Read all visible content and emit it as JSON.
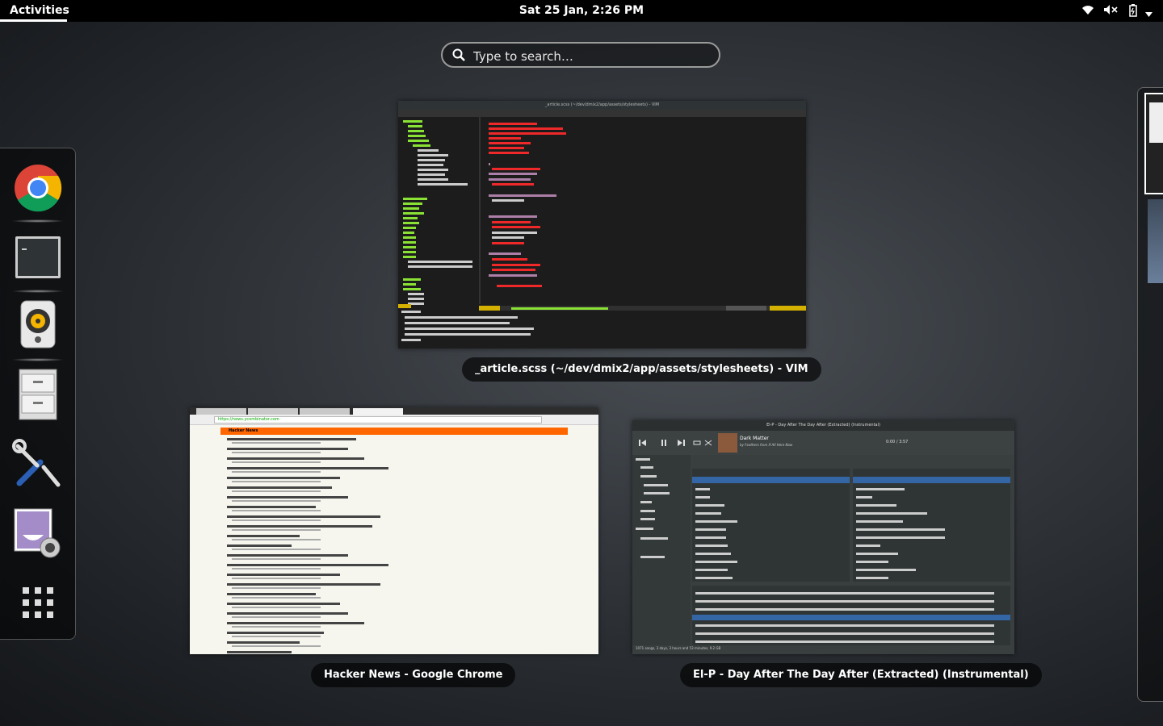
{
  "topbar": {
    "activities": "Activities",
    "clock": "Sat 25 Jan,  2:26 PM",
    "icons": [
      "wifi-icon",
      "volume-muted-icon",
      "battery-icon",
      "system-menu-arrow-icon"
    ]
  },
  "search": {
    "placeholder": "Type to search…"
  },
  "dash": {
    "apps": [
      {
        "name": "chrome-icon",
        "running": true
      },
      {
        "name": "terminal-icon",
        "running": true
      },
      {
        "name": "rhythmbox-icon",
        "running": true
      },
      {
        "name": "files-icon",
        "running": false
      },
      {
        "name": "settings-icon",
        "running": false
      },
      {
        "name": "cheese-icon",
        "running": false
      },
      {
        "name": "show-apps-icon",
        "running": false
      }
    ]
  },
  "windows": {
    "vim": {
      "caption": "_article.scss (~/dev/dmix2/app/assets/stylesheets) - VIM",
      "titlebar": "_article.scss (~/dev/dmix2/app/assets/stylesheets) - VIM"
    },
    "chrome": {
      "caption": "Hacker News - Google Chrome",
      "url": "https://news.ycombinator.com",
      "site": "Hacker News"
    },
    "rhythmbox": {
      "caption": "El-P - Day After The Day After (Extracted) (Instrumental)",
      "titlebar": "El-P - Day After The Day After (Extracted) (Instrumental)",
      "now_playing": "Dark Matter",
      "now_playing_sub": "by Feathers from If All Here Now",
      "time": "0:00 / 3:57",
      "status": "1071 songs, 3 days, 3 hours and 53 minutes, 9.2 GB"
    }
  },
  "colors": {
    "hn_orange": "#ff6600",
    "vim_bg": "#1c1c1c",
    "rb_select": "#3465a4"
  }
}
